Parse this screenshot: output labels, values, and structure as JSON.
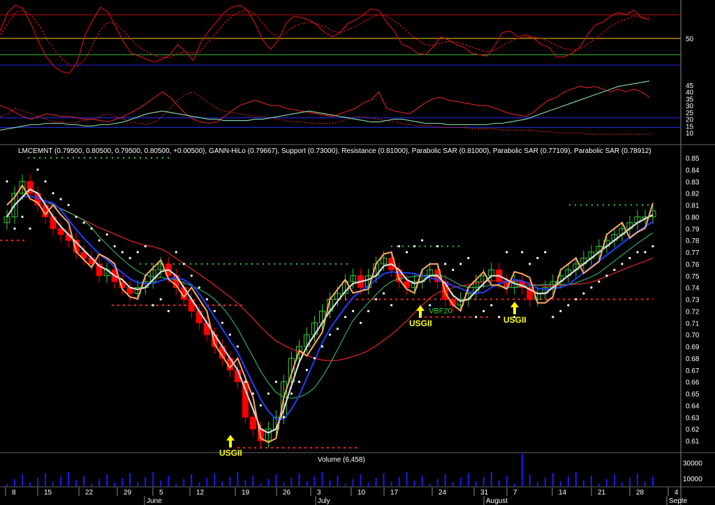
{
  "title": "LMCEMNT (0.79500, 0.80500, 0.79500, 0.80500, +0.00500), GANN-HiLo (0.79667), Support (0.73000), Resistance (0.81000), Parabolic SAR (0.81000), Parabolic SAR (0.77109), Parabolic SAR (0.78912)",
  "volume_label": "Volume (6,458)",
  "signals": [
    "USGII",
    "USGII",
    "USGII",
    "VBF20"
  ],
  "colors": {
    "background": "#000000",
    "up_candle": "#33cc33",
    "down_candle": "#ff0000",
    "gann": "#ffaa66",
    "ma_fast": "#dddddd",
    "ma_mid": "#1f3fff",
    "ma_slow": "#cc2222",
    "ma_green": "#33aa66",
    "sar": "#ffffff",
    "support": "#ff2222",
    "resistance": "#33cc33",
    "volume": "#1a1aff",
    "signal": "#ffff00"
  },
  "chart_data": [
    {
      "type": "line",
      "panel": "oscillator-1",
      "y_ticks": [
        "50"
      ],
      "levels": [
        82,
        50,
        28,
        14
      ],
      "ylim": [
        0,
        100
      ],
      "series": [
        {
          "color": "#cc1111",
          "values": [
            60,
            85,
            95,
            90,
            70,
            45,
            25,
            12,
            5,
            3,
            18,
            55,
            75,
            92,
            85,
            65,
            45,
            30,
            26,
            22,
            18,
            22,
            28,
            42,
            32,
            20,
            45,
            60,
            72,
            85,
            92,
            95,
            88,
            70,
            48,
            35,
            48,
            70,
            80,
            78,
            75,
            68,
            58,
            52,
            58,
            70,
            75,
            82,
            90,
            88,
            72,
            60,
            42,
            38,
            30,
            28,
            38,
            52,
            48,
            42,
            38,
            30,
            28,
            26,
            40,
            58,
            60,
            52,
            55,
            50,
            42,
            38,
            25,
            25,
            30,
            38,
            55,
            68,
            72,
            80,
            85,
            82,
            88,
            78,
            75
          ]
        },
        {
          "color": "#cc1111",
          "dashed": true,
          "values": [
            55,
            70,
            85,
            88,
            82,
            68,
            50,
            35,
            22,
            14,
            12,
            22,
            42,
            62,
            72,
            70,
            60,
            48,
            38,
            32,
            27,
            24,
            24,
            30,
            32,
            30,
            34,
            45,
            58,
            70,
            80,
            86,
            88,
            83,
            70,
            58,
            52,
            58,
            66,
            70,
            72,
            70,
            66,
            60,
            58,
            62,
            66,
            72,
            78,
            82,
            80,
            74,
            66,
            56,
            48,
            42,
            40,
            44,
            46,
            45,
            42,
            38,
            35,
            32,
            34,
            40,
            46,
            50,
            52,
            52,
            50,
            46,
            40,
            36,
            34,
            36,
            42,
            50,
            58,
            66,
            72,
            76,
            80,
            79,
            78
          ]
        }
      ]
    },
    {
      "type": "line",
      "panel": "oscillator-2",
      "y_ticks": [
        "45",
        "40",
        "35",
        "30",
        "25",
        "20",
        "15",
        "10"
      ],
      "levels": [
        21,
        14
      ],
      "ylim": [
        5,
        50
      ],
      "series": [
        {
          "color": "#dd2222",
          "values": [
            30,
            28,
            25,
            22,
            20,
            22,
            24,
            23,
            22,
            22,
            21,
            20,
            20,
            19,
            18,
            20,
            22,
            25,
            28,
            32,
            36,
            40,
            36,
            30,
            24,
            20,
            18,
            17,
            18,
            22,
            26,
            30,
            32,
            34,
            32,
            30,
            30,
            28,
            27,
            26,
            25,
            24,
            23,
            22,
            24,
            26,
            28,
            32,
            34,
            40,
            28,
            26,
            25,
            24,
            28,
            32,
            35,
            36,
            34,
            33,
            32,
            31,
            30,
            30,
            28,
            26,
            24,
            23,
            22,
            25,
            30,
            34,
            36,
            40,
            42,
            44,
            43,
            44,
            42,
            40,
            42,
            40,
            42,
            40,
            36
          ]
        },
        {
          "color": "#dd2222",
          "dashed": true,
          "values": [
            22,
            24,
            28,
            26,
            24,
            22,
            20,
            18,
            18,
            17,
            18,
            19,
            20,
            22,
            24,
            22,
            20,
            18,
            17,
            16,
            18,
            22,
            28,
            34,
            38,
            40,
            36,
            32,
            28,
            26,
            25,
            24,
            23,
            22,
            22,
            21,
            20,
            19,
            18,
            18,
            17,
            17,
            17,
            17,
            18,
            20,
            22,
            22,
            21,
            20,
            19,
            18,
            17,
            16,
            15,
            15,
            15,
            14,
            14,
            14,
            14,
            13,
            13,
            13,
            13,
            12,
            12,
            12,
            12,
            12,
            11,
            11,
            10,
            10,
            10,
            10,
            9,
            9,
            9,
            9,
            9,
            9,
            9,
            9,
            9
          ]
        },
        {
          "color": "#88ddaa",
          "values": [
            12,
            13,
            14,
            15,
            16,
            16,
            17,
            17,
            17,
            16,
            16,
            15,
            15,
            16,
            16,
            17,
            18,
            20,
            22,
            24,
            25,
            26,
            25,
            24,
            23,
            22,
            21,
            20,
            20,
            19,
            19,
            19,
            19,
            20,
            20,
            21,
            22,
            23,
            24,
            25,
            26,
            25,
            24,
            23,
            22,
            21,
            20,
            19,
            18,
            18,
            19,
            20,
            20,
            19,
            18,
            17,
            17,
            17,
            16,
            16,
            16,
            16,
            16,
            16,
            17,
            17,
            18,
            19,
            20,
            22,
            24,
            26,
            28,
            30,
            32,
            34,
            36,
            38,
            40,
            42,
            44,
            45,
            46,
            47,
            48
          ]
        }
      ]
    },
    {
      "type": "candlestick",
      "panel": "price",
      "x_labels": [
        "8",
        "15",
        "22",
        "29",
        "5",
        "12",
        "19",
        "26",
        "3",
        "10",
        "17",
        "24",
        "31",
        "7",
        "14",
        "21",
        "28",
        "4"
      ],
      "months": [
        "June",
        "July",
        "August",
        "Septe"
      ],
      "y_ticks": [
        "0.85",
        "0.84",
        "0.83",
        "0.82",
        "0.81",
        "0.80",
        "0.79",
        "0.78",
        "0.77",
        "0.76",
        "0.75",
        "0.74",
        "0.73",
        "0.72",
        "0.71",
        "0.70",
        "0.69",
        "0.68",
        "0.67",
        "0.66",
        "0.65",
        "0.64",
        "0.63",
        "0.62",
        "0.61"
      ],
      "ylim": [
        0.6,
        0.86
      ],
      "support": 0.73,
      "resistance": 0.81,
      "close": [
        0.8,
        0.82,
        0.83,
        0.82,
        0.81,
        0.8,
        0.79,
        0.785,
        0.78,
        0.77,
        0.765,
        0.76,
        0.75,
        0.755,
        0.745,
        0.74,
        0.735,
        0.74,
        0.745,
        0.755,
        0.76,
        0.75,
        0.74,
        0.73,
        0.72,
        0.71,
        0.7,
        0.69,
        0.68,
        0.67,
        0.66,
        0.63,
        0.62,
        0.61,
        0.62,
        0.63,
        0.66,
        0.68,
        0.69,
        0.7,
        0.71,
        0.72,
        0.73,
        0.735,
        0.745,
        0.75,
        0.74,
        0.75,
        0.76,
        0.765,
        0.755,
        0.745,
        0.74,
        0.745,
        0.75,
        0.755,
        0.745,
        0.73,
        0.725,
        0.73,
        0.735,
        0.745,
        0.75,
        0.755,
        0.745,
        0.74,
        0.745,
        0.74,
        0.73,
        0.735,
        0.74,
        0.745,
        0.75,
        0.755,
        0.76,
        0.765,
        0.77,
        0.775,
        0.78,
        0.785,
        0.79,
        0.795,
        0.8,
        0.8,
        0.805
      ],
      "volume_ylim": [
        0,
        40000
      ],
      "volume_ticks": [
        "30000",
        "10000"
      ]
    }
  ]
}
